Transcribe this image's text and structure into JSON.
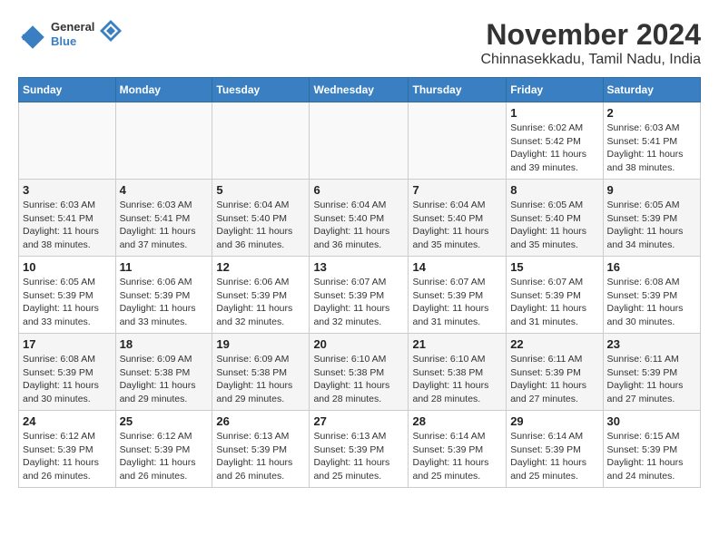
{
  "logo": {
    "line1": "General",
    "line2": "Blue"
  },
  "title": "November 2024",
  "subtitle": "Chinnasekkadu, Tamil Nadu, India",
  "weekdays": [
    "Sunday",
    "Monday",
    "Tuesday",
    "Wednesday",
    "Thursday",
    "Friday",
    "Saturday"
  ],
  "weeks": [
    [
      {
        "day": "",
        "info": ""
      },
      {
        "day": "",
        "info": ""
      },
      {
        "day": "",
        "info": ""
      },
      {
        "day": "",
        "info": ""
      },
      {
        "day": "",
        "info": ""
      },
      {
        "day": "1",
        "info": "Sunrise: 6:02 AM\nSunset: 5:42 PM\nDaylight: 11 hours and 39 minutes."
      },
      {
        "day": "2",
        "info": "Sunrise: 6:03 AM\nSunset: 5:41 PM\nDaylight: 11 hours and 38 minutes."
      }
    ],
    [
      {
        "day": "3",
        "info": "Sunrise: 6:03 AM\nSunset: 5:41 PM\nDaylight: 11 hours and 38 minutes."
      },
      {
        "day": "4",
        "info": "Sunrise: 6:03 AM\nSunset: 5:41 PM\nDaylight: 11 hours and 37 minutes."
      },
      {
        "day": "5",
        "info": "Sunrise: 6:04 AM\nSunset: 5:40 PM\nDaylight: 11 hours and 36 minutes."
      },
      {
        "day": "6",
        "info": "Sunrise: 6:04 AM\nSunset: 5:40 PM\nDaylight: 11 hours and 36 minutes."
      },
      {
        "day": "7",
        "info": "Sunrise: 6:04 AM\nSunset: 5:40 PM\nDaylight: 11 hours and 35 minutes."
      },
      {
        "day": "8",
        "info": "Sunrise: 6:05 AM\nSunset: 5:40 PM\nDaylight: 11 hours and 35 minutes."
      },
      {
        "day": "9",
        "info": "Sunrise: 6:05 AM\nSunset: 5:39 PM\nDaylight: 11 hours and 34 minutes."
      }
    ],
    [
      {
        "day": "10",
        "info": "Sunrise: 6:05 AM\nSunset: 5:39 PM\nDaylight: 11 hours and 33 minutes."
      },
      {
        "day": "11",
        "info": "Sunrise: 6:06 AM\nSunset: 5:39 PM\nDaylight: 11 hours and 33 minutes."
      },
      {
        "day": "12",
        "info": "Sunrise: 6:06 AM\nSunset: 5:39 PM\nDaylight: 11 hours and 32 minutes."
      },
      {
        "day": "13",
        "info": "Sunrise: 6:07 AM\nSunset: 5:39 PM\nDaylight: 11 hours and 32 minutes."
      },
      {
        "day": "14",
        "info": "Sunrise: 6:07 AM\nSunset: 5:39 PM\nDaylight: 11 hours and 31 minutes."
      },
      {
        "day": "15",
        "info": "Sunrise: 6:07 AM\nSunset: 5:39 PM\nDaylight: 11 hours and 31 minutes."
      },
      {
        "day": "16",
        "info": "Sunrise: 6:08 AM\nSunset: 5:39 PM\nDaylight: 11 hours and 30 minutes."
      }
    ],
    [
      {
        "day": "17",
        "info": "Sunrise: 6:08 AM\nSunset: 5:39 PM\nDaylight: 11 hours and 30 minutes."
      },
      {
        "day": "18",
        "info": "Sunrise: 6:09 AM\nSunset: 5:38 PM\nDaylight: 11 hours and 29 minutes."
      },
      {
        "day": "19",
        "info": "Sunrise: 6:09 AM\nSunset: 5:38 PM\nDaylight: 11 hours and 29 minutes."
      },
      {
        "day": "20",
        "info": "Sunrise: 6:10 AM\nSunset: 5:38 PM\nDaylight: 11 hours and 28 minutes."
      },
      {
        "day": "21",
        "info": "Sunrise: 6:10 AM\nSunset: 5:38 PM\nDaylight: 11 hours and 28 minutes."
      },
      {
        "day": "22",
        "info": "Sunrise: 6:11 AM\nSunset: 5:39 PM\nDaylight: 11 hours and 27 minutes."
      },
      {
        "day": "23",
        "info": "Sunrise: 6:11 AM\nSunset: 5:39 PM\nDaylight: 11 hours and 27 minutes."
      }
    ],
    [
      {
        "day": "24",
        "info": "Sunrise: 6:12 AM\nSunset: 5:39 PM\nDaylight: 11 hours and 26 minutes."
      },
      {
        "day": "25",
        "info": "Sunrise: 6:12 AM\nSunset: 5:39 PM\nDaylight: 11 hours and 26 minutes."
      },
      {
        "day": "26",
        "info": "Sunrise: 6:13 AM\nSunset: 5:39 PM\nDaylight: 11 hours and 26 minutes."
      },
      {
        "day": "27",
        "info": "Sunrise: 6:13 AM\nSunset: 5:39 PM\nDaylight: 11 hours and 25 minutes."
      },
      {
        "day": "28",
        "info": "Sunrise: 6:14 AM\nSunset: 5:39 PM\nDaylight: 11 hours and 25 minutes."
      },
      {
        "day": "29",
        "info": "Sunrise: 6:14 AM\nSunset: 5:39 PM\nDaylight: 11 hours and 25 minutes."
      },
      {
        "day": "30",
        "info": "Sunrise: 6:15 AM\nSunset: 5:39 PM\nDaylight: 11 hours and 24 minutes."
      }
    ]
  ]
}
